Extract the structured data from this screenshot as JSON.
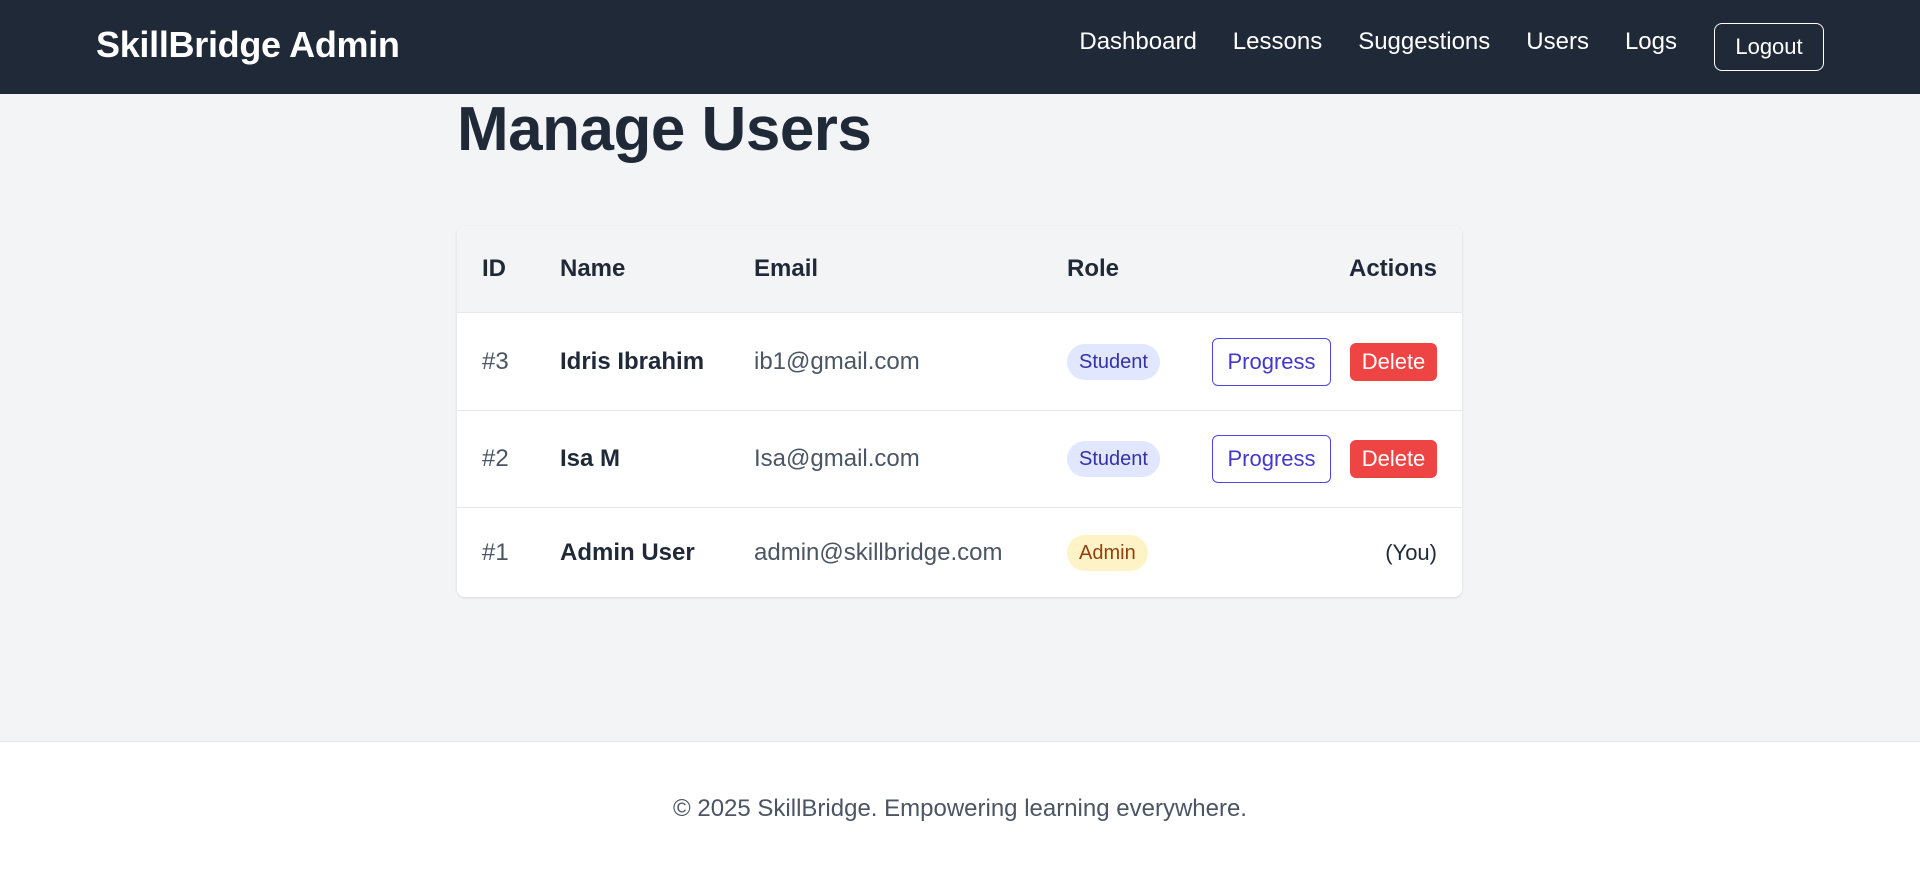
{
  "header": {
    "brand": "SkillBridge Admin",
    "nav": [
      "Dashboard",
      "Lessons",
      "Suggestions",
      "Users",
      "Logs"
    ],
    "logout_label": "Logout"
  },
  "main": {
    "title": "Manage Users",
    "table": {
      "columns": [
        "ID",
        "Name",
        "Email",
        "Role",
        "Actions"
      ],
      "rows": [
        {
          "id": "#3",
          "name": "Idris Ibrahim",
          "email": "ib1@gmail.com",
          "role": "Student",
          "progress_label": "Progress",
          "delete_label": "Delete"
        },
        {
          "id": "#2",
          "name": "Isa M",
          "email": "Isa@gmail.com",
          "role": "Student",
          "progress_label": "Progress",
          "delete_label": "Delete"
        },
        {
          "id": "#1",
          "name": "Admin User",
          "email": "admin@skillbridge.com",
          "role": "Admin",
          "self_label": "(You)"
        }
      ]
    }
  },
  "footer": {
    "text": "© 2025 SkillBridge. Empowering learning everywhere."
  },
  "colors": {
    "header_bg": "#1f2937",
    "page_bg": "#f3f4f6",
    "student_badge_bg": "#e0e7ff",
    "student_badge_text": "#3730a3",
    "admin_badge_bg": "#fef3c7",
    "admin_badge_text": "#92400e",
    "progress_accent": "#4f46e5",
    "delete_bg": "#ef4444"
  }
}
